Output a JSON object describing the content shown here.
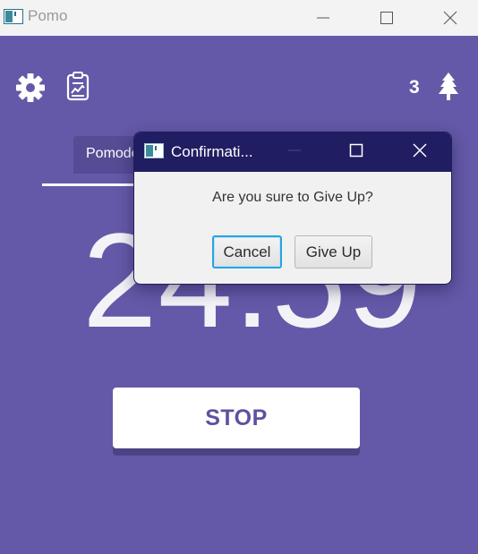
{
  "window": {
    "title": "Pomo",
    "controls": {
      "minimize": "minimize-icon",
      "maximize": "maximize-icon",
      "close": "close-icon"
    }
  },
  "toolbar": {
    "settings_icon": "gear-icon",
    "report_icon": "clipboard-chart-icon",
    "tree_count": "3",
    "tree_icon": "pine-tree-icon"
  },
  "tabs": {
    "active_label": "Pomodoro"
  },
  "timer": {
    "display": "24:59"
  },
  "stop_button": {
    "label": "STOP"
  },
  "dialog": {
    "title": "Confirmati...",
    "message": "Are you sure to Give Up?",
    "cancel_label": "Cancel",
    "confirm_label": "Give Up"
  },
  "colors": {
    "background": "#6459a8",
    "dialog_titlebar": "#201d62",
    "stop_text": "#5d52a0",
    "focus_ring": "#2aa3e0"
  }
}
